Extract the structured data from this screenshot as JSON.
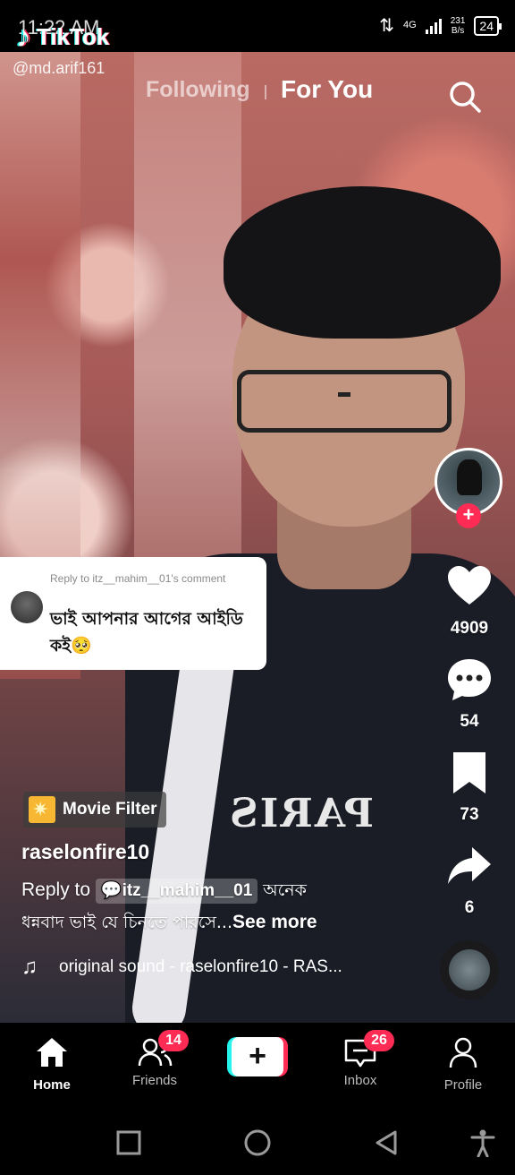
{
  "status_bar": {
    "time": "11:22 AM",
    "network_type": "4G",
    "speed_value": "231",
    "speed_unit": "B/s",
    "battery": "24"
  },
  "watermark": {
    "brand": "TikTok",
    "handle": "@md.arif161"
  },
  "top_tabs": {
    "following": "Following",
    "for_you": "For You",
    "search_icon": "search-icon"
  },
  "right_rail": {
    "follow_plus": "+",
    "likes": "4909",
    "comments": "54",
    "saves": "73",
    "shares": "6"
  },
  "reply_card": {
    "header": "Reply to itz__mahim__01's comment",
    "text": "ভাই আপনার আগের আইডি কই🥺"
  },
  "video_info": {
    "filter_label": "Movie Filter",
    "username": "raselonfire10",
    "caption_prefix": "Reply to",
    "caption_tag": "itz__mahim__01",
    "caption_line1_bn": "অনেক",
    "caption_line2_bn": "ধন্নবাদ ভাই যে চিনতে পারসে...",
    "see_more": "See more",
    "sound": "original sound - raselonfire10 - RAS..."
  },
  "bottom_nav": {
    "home": "Home",
    "friends": "Friends",
    "friends_badge": "14",
    "create": "+",
    "inbox": "Inbox",
    "inbox_badge": "26",
    "profile": "Profile"
  },
  "overlay_text": "PARIS",
  "colors": {
    "accent_pink": "#fe2c55",
    "accent_cyan": "#25f4ee"
  }
}
